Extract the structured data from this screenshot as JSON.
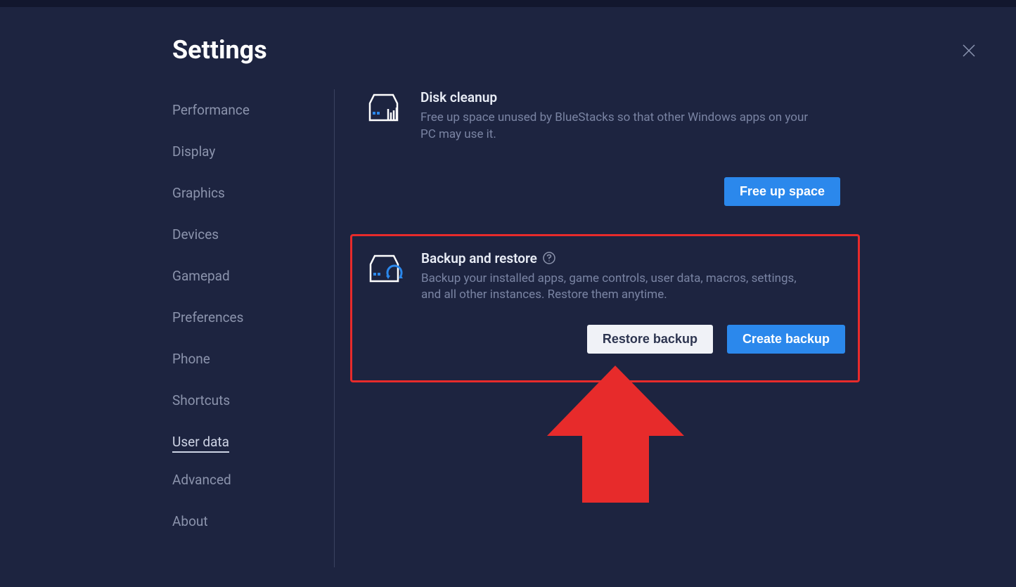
{
  "page_title": "Settings",
  "sidebar": {
    "items": [
      {
        "label": "Performance"
      },
      {
        "label": "Display"
      },
      {
        "label": "Graphics"
      },
      {
        "label": "Devices"
      },
      {
        "label": "Gamepad"
      },
      {
        "label": "Preferences"
      },
      {
        "label": "Phone"
      },
      {
        "label": "Shortcuts"
      },
      {
        "label": "User data"
      },
      {
        "label": "Advanced"
      },
      {
        "label": "About"
      }
    ],
    "active_index": 8
  },
  "content": {
    "disk_cleanup": {
      "title": "Disk cleanup",
      "description": "Free up space unused by BlueStacks so that other Windows apps on your PC may use it.",
      "button_label": "Free up space"
    },
    "backup_restore": {
      "title": "Backup and restore",
      "description": "Backup your installed apps, game controls, user data, macros, settings, and all other instances. Restore them anytime.",
      "restore_button_label": "Restore backup",
      "create_button_label": "Create backup"
    }
  },
  "colors": {
    "background": "#1d2440",
    "accent": "#2b88ec",
    "highlight": "#e72b2b"
  }
}
